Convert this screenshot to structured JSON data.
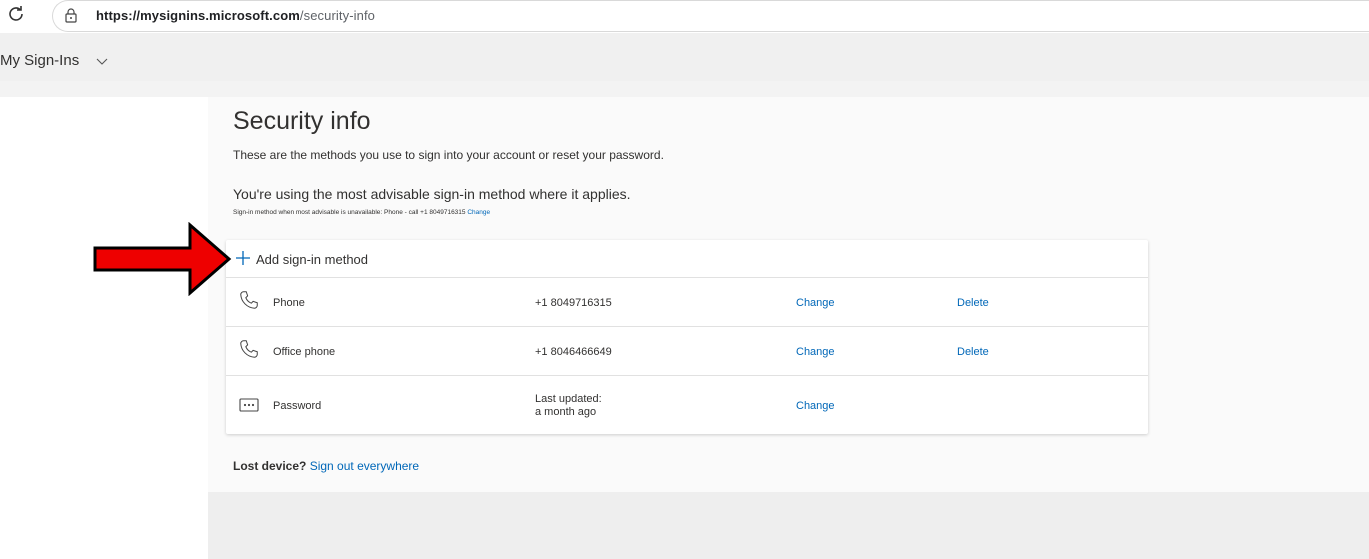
{
  "browser": {
    "url_domain": "https://mysignins.microsoft.com",
    "url_path": "/security-info"
  },
  "header": {
    "app_title": "My Sign-Ins"
  },
  "main": {
    "title": "Security info",
    "description": "These are the methods you use to sign into your account or reset your password.",
    "advisable": "You're using the most advisable sign-in method where it applies.",
    "fallback_text": "Sign-in method when most advisable is unavailable: Phone - call +1 8049716315",
    "fallback_change": "Change",
    "add_method_label": "Add sign-in method",
    "methods": [
      {
        "icon": "phone-icon",
        "name": "Phone",
        "value": "+1 8049716315",
        "change": "Change",
        "delete": "Delete"
      },
      {
        "icon": "phone-icon",
        "name": "Office phone",
        "value": "+1 8046466649",
        "change": "Change",
        "delete": "Delete"
      },
      {
        "icon": "password-icon",
        "name": "Password",
        "value_line1": "Last updated:",
        "value_line2": "a month ago",
        "change": "Change"
      }
    ],
    "lost_device_label": "Lost device?",
    "sign_out_everywhere": "Sign out everywhere"
  },
  "colors": {
    "link": "#0067b8",
    "accent": "#0067b8",
    "arrow": "#ee0000"
  }
}
